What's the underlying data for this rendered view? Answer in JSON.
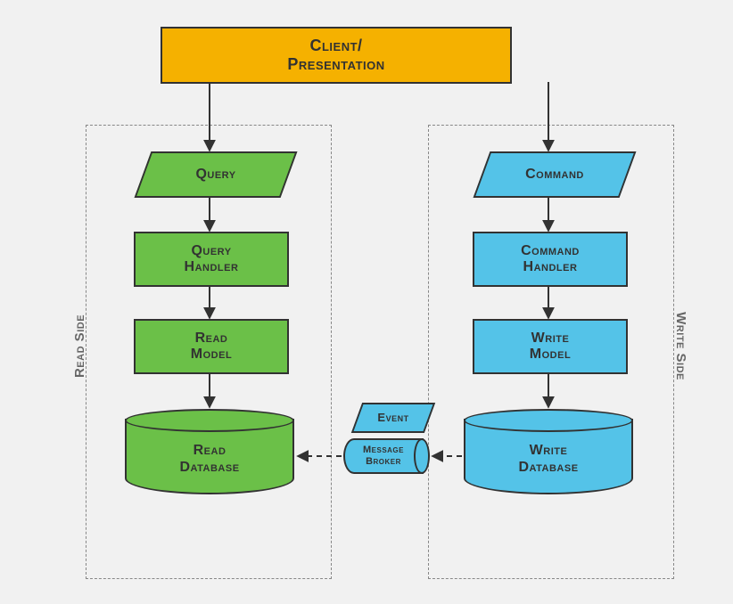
{
  "colors": {
    "amber": "#f5b100",
    "green": "#6bc048",
    "blue": "#54c3e8",
    "ink": "#323232",
    "dash": "#878787",
    "bg": "#f1f1f1"
  },
  "client": {
    "label": "Client/\nPresentation"
  },
  "sides": {
    "read": {
      "caption": "Read Side"
    },
    "write": {
      "caption": "Write Side"
    }
  },
  "read": {
    "query": "Query",
    "handler": "Query\nHandler",
    "model": "Read\nModel",
    "db": "Read\nDatabase"
  },
  "write": {
    "command": "Command",
    "handler": "Command\nHandler",
    "model": "Write\nModel",
    "db": "Write\nDatabase"
  },
  "bus": {
    "event": "Event",
    "broker": "Message\nBroker"
  }
}
